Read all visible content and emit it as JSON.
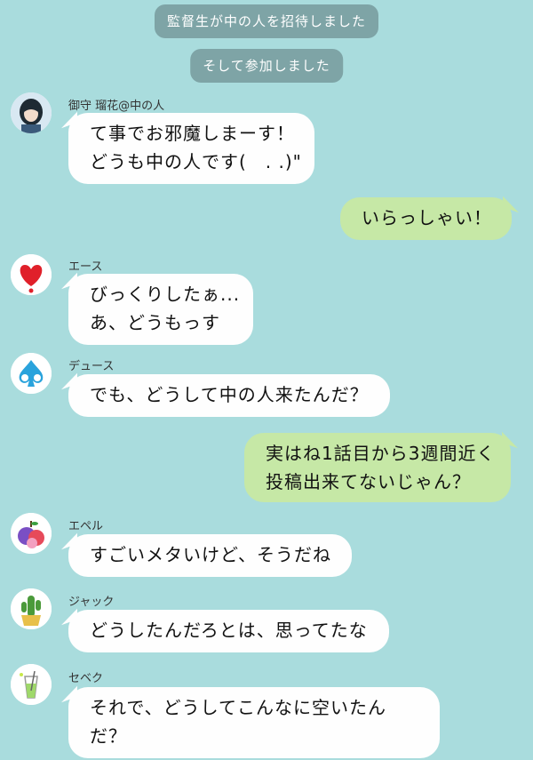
{
  "system_messages": [
    "監督生が中の人を招待しました",
    "そして参加しました"
  ],
  "messages": [
    {
      "sender": "御守 瑠花@中の人",
      "lines": [
        "て事でお邪魔しまーす！",
        "どうも中の人です(　. .)\""
      ],
      "avatar_icon": "girl-avatar-icon"
    },
    {
      "sender": "",
      "lines": [
        "いらっしゃい！"
      ],
      "own": true
    },
    {
      "sender": "エース",
      "lines": [
        "びっくりしたぁ...",
        "あ、どうもっす"
      ],
      "avatar_icon": "heart-avatar-icon"
    },
    {
      "sender": "デュース",
      "lines": [
        "でも、どうして中の人来たんだ？"
      ],
      "avatar_icon": "spade-avatar-icon"
    },
    {
      "sender": "",
      "lines": [
        "実はね1話目から3週間近く",
        "投稿出来てないじゃん？"
      ],
      "own": true
    },
    {
      "sender": "エペル",
      "lines": [
        "すごいメタいけど、そうだね"
      ],
      "avatar_icon": "apple-avatar-icon"
    },
    {
      "sender": "ジャック",
      "lines": [
        "どうしたんだろとは、思ってたな"
      ],
      "avatar_icon": "cactus-avatar-icon"
    },
    {
      "sender": "セベク",
      "lines": [
        "それで、どうしてこんなに空いたん",
        "だ？"
      ],
      "avatar_icon": "drink-avatar-icon"
    }
  ],
  "colors": {
    "background": "#a9dcdd",
    "system_bubble": "#7ea4a6",
    "incoming_bubble": "#fefefe",
    "outgoing_bubble": "#c6e8a6"
  }
}
